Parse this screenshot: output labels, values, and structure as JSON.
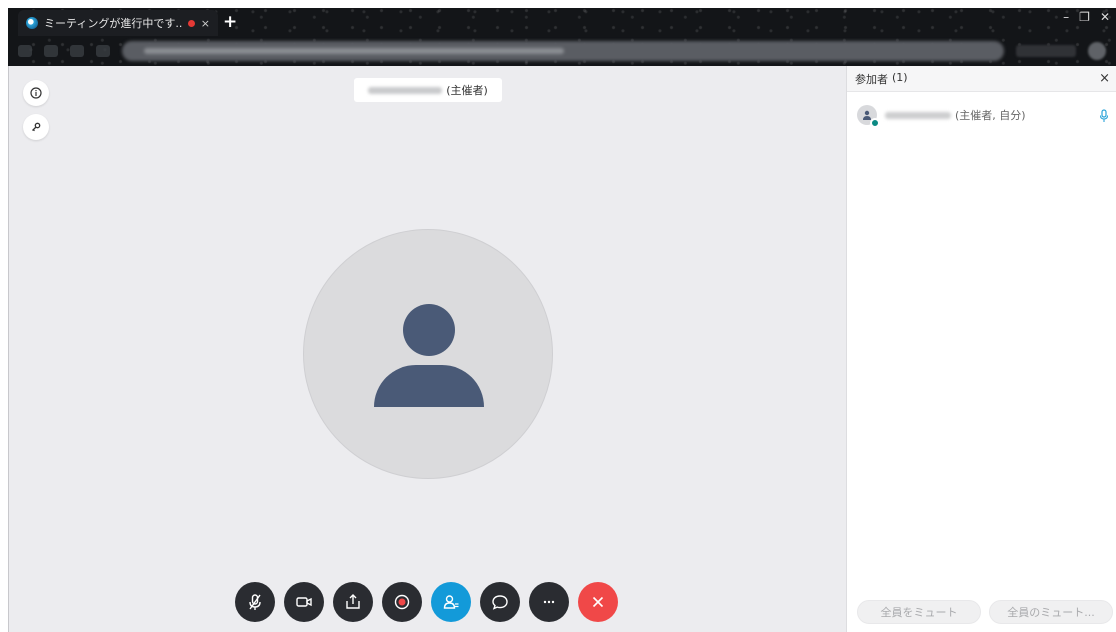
{
  "browser": {
    "tab_title": "ミーティングが進行中です...",
    "tab_close": "×",
    "new_tab": "+",
    "window_controls": [
      "–",
      "❐",
      "✕"
    ]
  },
  "meeting": {
    "host_suffix": "(主催者)",
    "info_icon": "info-icon",
    "key_icon": "key-icon",
    "controls": [
      {
        "name": "mute-button",
        "icon": "mic-off-icon"
      },
      {
        "name": "video-button",
        "icon": "camera-icon"
      },
      {
        "name": "share-button",
        "icon": "share-icon"
      },
      {
        "name": "record-button",
        "icon": "record-icon"
      },
      {
        "name": "participants-button",
        "icon": "participants-icon"
      },
      {
        "name": "chat-button",
        "icon": "chat-icon"
      },
      {
        "name": "more-button",
        "icon": "more-icon"
      },
      {
        "name": "leave-button",
        "icon": "close-icon"
      }
    ],
    "colors": {
      "control_dark": "#2a2c31",
      "control_active": "#139ad9",
      "control_leave": "#f04848",
      "avatar": "#4a5a77"
    }
  },
  "participants": {
    "title": "参加者",
    "count": "(1)",
    "close": "×",
    "list": [
      {
        "role": "(主催者, 自分)"
      }
    ],
    "mute_all": "全員をミュート",
    "unmute_all": "全員のミュート..."
  }
}
